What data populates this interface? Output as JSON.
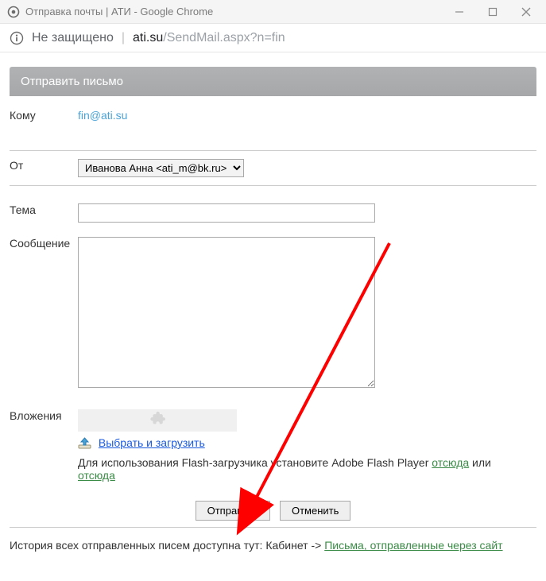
{
  "window": {
    "title": "Отправка почты | АТИ - Google Chrome"
  },
  "addressbar": {
    "security_text": "Не защищено",
    "host": "ati.su",
    "path": "/SendMail.aspx?n=fin"
  },
  "panel": {
    "header": "Отправить письмо"
  },
  "form": {
    "to_label": "Кому",
    "to_value": "fin@ati.su",
    "from_label": "От",
    "from_value": "Иванова Анна <ati_m@bk.ru>",
    "subject_label": "Тема",
    "subject_value": "",
    "message_label": "Сообщение",
    "message_value": "",
    "attach_label": "Вложения",
    "upload_link": "Выбрать и загрузить",
    "flash_note_pre": "Для использования Flash-загрузчика установите Adobe Flash Player ",
    "flash_link1": "отсюда",
    "flash_note_mid": " или ",
    "flash_link2": "отсюда",
    "submit_label": "Отправить",
    "cancel_label": "Отменить"
  },
  "history": {
    "pre": "История всех отправленных писем доступна тут: Кабинет -> ",
    "link": "Письма, отправленные через сайт"
  }
}
